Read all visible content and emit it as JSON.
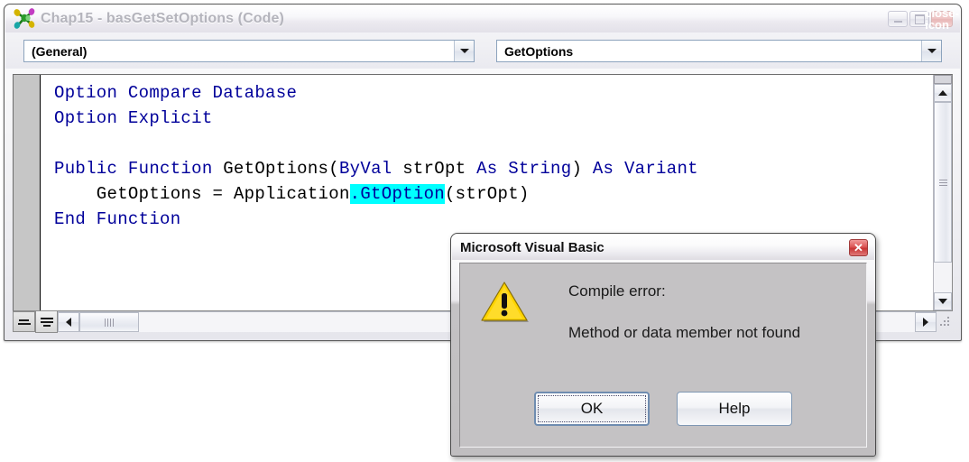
{
  "code_window": {
    "title": "Chap15 - basGetSetOptions (Code)",
    "icon": "access-module-icon",
    "titlebar_buttons": [
      {
        "name": "minimize-button",
        "glyph": "minimize-icon",
        "label": "Minimize"
      },
      {
        "name": "maximize-button",
        "glyph": "maximize-icon",
        "label": "Maximize"
      },
      {
        "name": "close-button",
        "glyph": "close-icon",
        "label": "✕"
      }
    ],
    "object_combo": {
      "value": "(General)",
      "arrow": "chevron-down-icon"
    },
    "procedure_combo": {
      "value": "GetOptions",
      "arrow": "chevron-down-icon"
    },
    "code": {
      "lines": [
        [
          {
            "t": "Option Compare Database",
            "k": true
          }
        ],
        [
          {
            "t": "Option Explicit",
            "k": true
          }
        ],
        [
          {
            "t": "",
            "k": false
          }
        ],
        [
          {
            "t": "Public Function ",
            "k": true
          },
          {
            "t": "GetOptions(",
            "k": false
          },
          {
            "t": "ByVal ",
            "k": true
          },
          {
            "t": "strOpt ",
            "k": false
          },
          {
            "t": "As String",
            "k": true
          },
          {
            "t": ") ",
            "k": false
          },
          {
            "t": "As Variant",
            "k": true
          }
        ],
        [
          {
            "t": "    GetOptions = Application",
            "k": false
          },
          {
            "t": ".GtOption",
            "k": false,
            "sel": true
          },
          {
            "t": "(strOpt)",
            "k": false
          }
        ],
        [
          {
            "t": "End Function",
            "k": true
          }
        ]
      ],
      "selected_text": ".GtOption",
      "selection_color": "#00ffff",
      "keyword_color": "#00009a",
      "text_color": "#000000",
      "background_color": "#ffffff"
    },
    "view_buttons": [
      {
        "name": "procedure-view-button",
        "label": "Procedure View"
      },
      {
        "name": "full-module-view-button",
        "label": "Full Module View"
      }
    ],
    "scrollbars": {
      "vertical": {
        "up": "chevron-up-icon",
        "down": "chevron-down-icon"
      },
      "horizontal": {
        "left": "chevron-left-icon",
        "right": "chevron-right-icon"
      }
    }
  },
  "dialog": {
    "title": "Microsoft Visual Basic",
    "close_glyph": "✕",
    "icon": "warning-triangle-icon",
    "message_line1": "Compile error:",
    "message_line2": "Method or data member not found",
    "buttons": [
      {
        "name": "ok-button",
        "label": "OK",
        "default": true
      },
      {
        "name": "help-button",
        "label": "Help",
        "default": false
      }
    ]
  }
}
